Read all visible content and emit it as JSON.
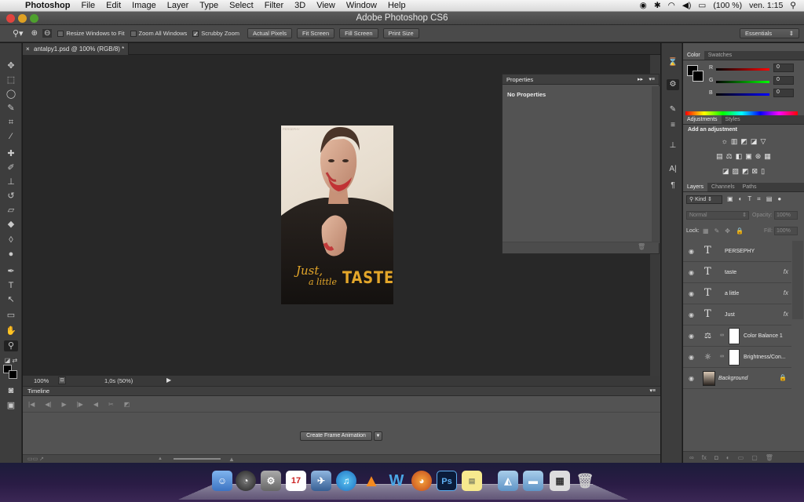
{
  "menubar": {
    "app": "Photoshop",
    "items": [
      "File",
      "Edit",
      "Image",
      "Layer",
      "Type",
      "Select",
      "Filter",
      "3D",
      "View",
      "Window",
      "Help"
    ],
    "battery": "(100 %)",
    "clock": "ven. 1:15"
  },
  "window": {
    "title": "Adobe Photoshop CS6"
  },
  "options": {
    "resize_windows": "Resize Windows to Fit",
    "zoom_all": "Zoom All Windows",
    "scrubby_zoom": "Scrubby Zoom",
    "actual_pixels": "Actual Pixels",
    "fit_screen": "Fit Screen",
    "fill_screen": "Fill Screen",
    "print_size": "Print Size",
    "workspace": "Essentials"
  },
  "document": {
    "tab": "antalpy1.psd @ 100% (RGB/8) *",
    "zoom": "100%",
    "timing": "1,0s (50%)"
  },
  "poster": {
    "just": "Just,",
    "a_little": "a little",
    "taste": "TASTE",
    "tiny": "PERSEPHY"
  },
  "properties": {
    "title": "Properties",
    "body": "No Properties"
  },
  "timeline": {
    "title": "Timeline",
    "create_button": "Create Frame Animation"
  },
  "color": {
    "tabs": [
      "Color",
      "Swatches"
    ],
    "r_label": "R",
    "g_label": "G",
    "b_label": "B",
    "r": "0",
    "g": "0",
    "b": "0"
  },
  "adjustments": {
    "tabs": [
      "Adjustments",
      "Styles"
    ],
    "heading": "Add an adjustment"
  },
  "layers": {
    "tabs": [
      "Layers",
      "Channels",
      "Paths"
    ],
    "kind": "Kind",
    "blend_mode": "Normal",
    "opacity_label": "Opacity:",
    "opacity": "100%",
    "lock_label": "Lock:",
    "fill_label": "Fill:",
    "fill": "100%",
    "list": [
      "PERSEPHY",
      "taste",
      "a little",
      "Just",
      "Color Balance 1",
      "Brightness/Con...",
      "Background"
    ],
    "fx_label": "fx"
  },
  "colors": {
    "accent_blue": "#2f6fd0",
    "panel": "#535353",
    "canvas": "#282828"
  }
}
